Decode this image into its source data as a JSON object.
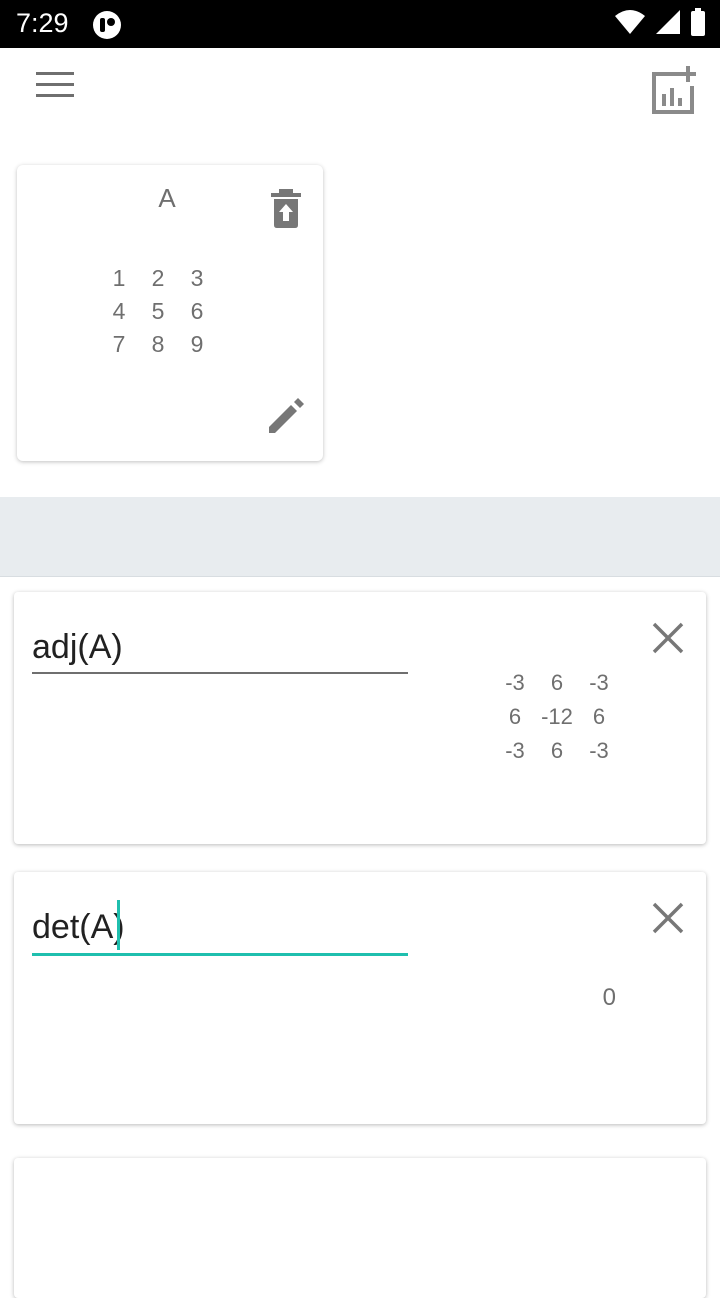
{
  "status_bar": {
    "time": "7:29",
    "icons": [
      "app-notification-icon",
      "wifi-icon",
      "signal-icon",
      "battery-icon"
    ]
  },
  "toolbar": {
    "menu_icon": "menu-icon",
    "add_chart_icon": "add-chart-icon"
  },
  "matrix_card": {
    "title": "A",
    "rows": [
      [
        "1",
        "2",
        "3"
      ],
      [
        "4",
        "5",
        "6"
      ],
      [
        "7",
        "8",
        "9"
      ]
    ],
    "delete_icon": "delete-icon",
    "edit_icon": "edit-icon"
  },
  "expressions": [
    {
      "input": "adj(A)",
      "result_rows": [
        [
          "-3",
          "6",
          "-3"
        ],
        [
          "6",
          "-12",
          "6"
        ],
        [
          "-3",
          "6",
          "-3"
        ]
      ],
      "close_icon": "close-icon"
    },
    {
      "input": "det(A)",
      "result": "0",
      "close_icon": "close-icon"
    }
  ],
  "colors": {
    "accent": "#1fbfae",
    "text_secondary": "#6f6f6f",
    "band": "#e8ecef"
  }
}
